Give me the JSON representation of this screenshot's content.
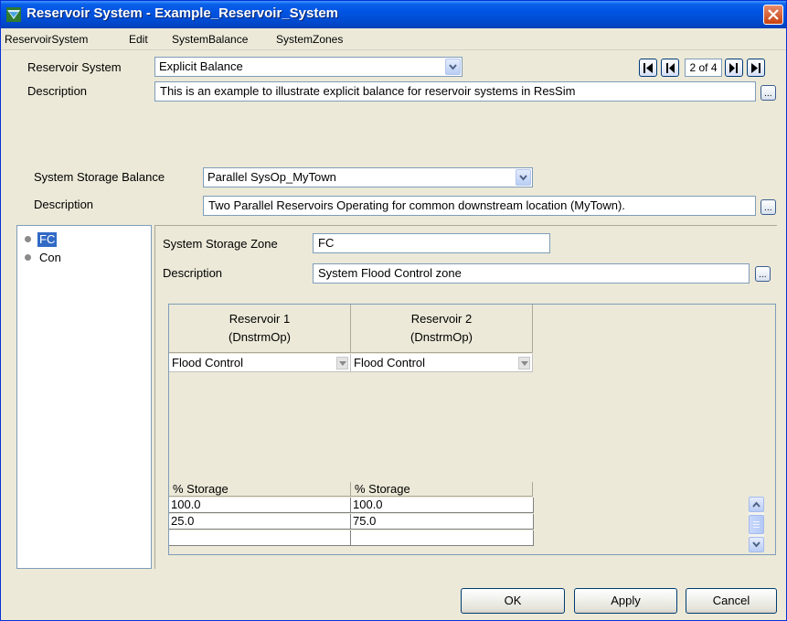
{
  "window": {
    "title": "Reservoir System - Example_Reservoir_System"
  },
  "menu": {
    "items": [
      "ReservoirSystem",
      "Edit",
      "SystemBalance",
      "SystemZones"
    ]
  },
  "reservoir_system": {
    "label": "Reservoir System",
    "value": "Explicit Balance",
    "description_label": "Description",
    "description": "This is an example to illustrate explicit balance for reservoir systems in ResSim",
    "nav_count": "2 of 4"
  },
  "storage_balance": {
    "label": "System Storage Balance",
    "value": "Parallel SysOp_MyTown",
    "description_label": "Description",
    "description": "Two Parallel Reservoirs Operating for common downstream location (MyTown)."
  },
  "zones": {
    "items": [
      "FC",
      "Con"
    ],
    "selected": "FC"
  },
  "zone_detail": {
    "zone_label": "System Storage Zone",
    "zone_value": "FC",
    "description_label": "Description",
    "description": "System Flood Control zone"
  },
  "grid": {
    "reservoirs": [
      {
        "name": "Reservoir 1",
        "op": "(DnstrmOp)",
        "operation": "Flood Control"
      },
      {
        "name": "Reservoir 2",
        "op": "(DnstrmOp)",
        "operation": "Flood Control"
      }
    ],
    "storage_header": "% Storage",
    "storage_rows": [
      [
        "100.0",
        "100.0"
      ],
      [
        "25.0",
        "75.0"
      ],
      [
        "",
        ""
      ]
    ]
  },
  "buttons": {
    "ok": "OK",
    "apply": "Apply",
    "cancel": "Cancel"
  },
  "colors": {
    "titlebar": "#0054e3",
    "dialog_bg": "#ece9d8",
    "selection": "#316ac5"
  }
}
